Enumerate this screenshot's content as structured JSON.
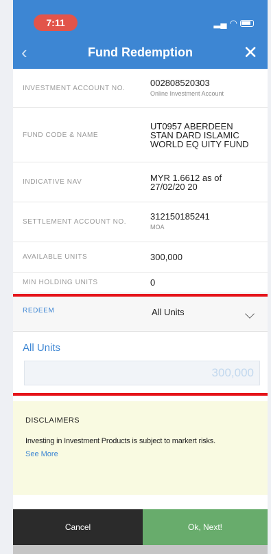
{
  "status": {
    "time": "7:11",
    "signal_glyph": "▂▄",
    "wifi_glyph": "◠"
  },
  "header": {
    "title": "Fund Redemption",
    "back_glyph": "‹",
    "close_glyph": "✕"
  },
  "rows": [
    {
      "label": "INVESTMENT ACCOUNT NO.",
      "value": "002808520303",
      "sub": "Online Investment Account"
    },
    {
      "label": "FUND CODE & NAME",
      "value": "UT0957 ABERDEEN STAN DARD ISLAMIC WORLD EQ UITY FUND",
      "sub": ""
    },
    {
      "label": "INDICATIVE NAV",
      "value": "MYR 1.6612 as of 27/02/20 20",
      "sub": ""
    },
    {
      "label": "SETTLEMENT ACCOUNT NO.",
      "value": "312150185241",
      "sub": "MOA"
    },
    {
      "label": "AVAILABLE UNITS",
      "value": "300,000",
      "sub": ""
    },
    {
      "label": "MIN HOLDING UNITS",
      "value": "0",
      "sub": ""
    }
  ],
  "redeem": {
    "label": "REDEEM",
    "selected": "All Units",
    "units_label": "All Units",
    "units_placeholder": "300,000"
  },
  "disclaimer": {
    "title": "DISCLAIMERS",
    "text": "Investing in Investment Products is subject to markert risks.",
    "more": "See More"
  },
  "footer": {
    "cancel": "Cancel",
    "next": "Ok, Next!"
  },
  "colors": {
    "accent": "#3d86d3",
    "highlight": "#e5141a",
    "next": "#68ac6c",
    "cancel": "#2b2b2b"
  }
}
